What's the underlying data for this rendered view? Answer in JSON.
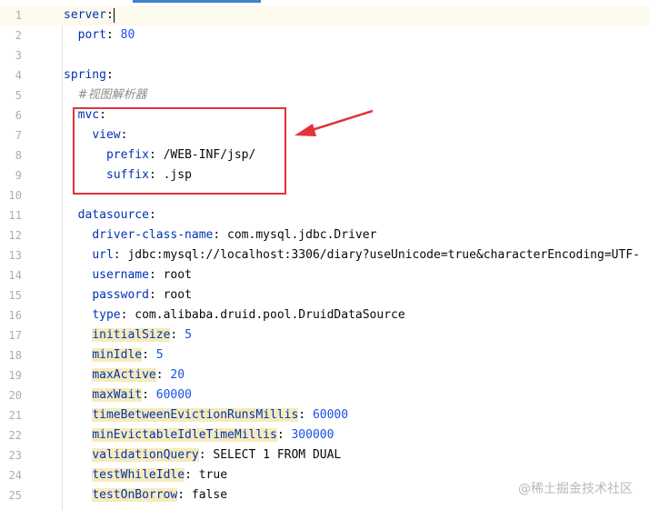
{
  "editor": {
    "lines": [
      {
        "n": "1",
        "indent": "",
        "key": "server",
        "value": "",
        "value_type": "",
        "caret": true
      },
      {
        "n": "2",
        "indent": "  ",
        "key": "port",
        "value": "80",
        "value_type": "num"
      },
      {
        "n": "3",
        "indent": "",
        "key": "",
        "value": "",
        "value_type": ""
      },
      {
        "n": "4",
        "indent": "",
        "key": "spring",
        "value": "",
        "value_type": ""
      },
      {
        "n": "5",
        "indent": "  ",
        "comment": "#视图解析器"
      },
      {
        "n": "6",
        "indent": "  ",
        "key": "mvc",
        "value": "",
        "value_type": ""
      },
      {
        "n": "7",
        "indent": "    ",
        "key": "view",
        "value": "",
        "value_type": ""
      },
      {
        "n": "8",
        "indent": "      ",
        "key": "prefix",
        "value": "/WEB-INF/jsp/",
        "value_type": "plain"
      },
      {
        "n": "9",
        "indent": "      ",
        "key": "suffix",
        "value": ".jsp",
        "value_type": "plain"
      },
      {
        "n": "10",
        "indent": "",
        "key": "",
        "value": "",
        "value_type": ""
      },
      {
        "n": "11",
        "indent": "  ",
        "key": "datasource",
        "value": "",
        "value_type": ""
      },
      {
        "n": "12",
        "indent": "    ",
        "key": "driver-class-name",
        "value": "com.mysql.jdbc.Driver",
        "value_type": "plain"
      },
      {
        "n": "13",
        "indent": "    ",
        "key": "url",
        "value": "jdbc:mysql://localhost:3306/diary?useUnicode=true&characterEncoding=UTF-",
        "value_type": "plain"
      },
      {
        "n": "14",
        "indent": "    ",
        "key": "username",
        "value": "root",
        "value_type": "plain"
      },
      {
        "n": "15",
        "indent": "    ",
        "key": "password",
        "value": "root",
        "value_type": "plain"
      },
      {
        "n": "16",
        "indent": "    ",
        "key": "type",
        "value": "com.alibaba.druid.pool.DruidDataSource",
        "value_type": "plain"
      },
      {
        "n": "17",
        "indent": "    ",
        "key": "initialSize",
        "value": "5",
        "value_type": "num",
        "hl": true
      },
      {
        "n": "18",
        "indent": "    ",
        "key": "minIdle",
        "value": "5",
        "value_type": "num",
        "hl": true
      },
      {
        "n": "19",
        "indent": "    ",
        "key": "maxActive",
        "value": "20",
        "value_type": "num",
        "hl": true
      },
      {
        "n": "20",
        "indent": "    ",
        "key": "maxWait",
        "value": "60000",
        "value_type": "num",
        "hl": true
      },
      {
        "n": "21",
        "indent": "    ",
        "key": "timeBetweenEvictionRunsMillis",
        "value": "60000",
        "value_type": "num",
        "hl": true
      },
      {
        "n": "22",
        "indent": "    ",
        "key": "minEvictableIdleTimeMillis",
        "value": "300000",
        "value_type": "num",
        "hl": true
      },
      {
        "n": "23",
        "indent": "    ",
        "key": "validationQuery",
        "value": "SELECT 1 FROM DUAL",
        "value_type": "plain",
        "hl": true
      },
      {
        "n": "24",
        "indent": "    ",
        "key": "testWhileIdle",
        "value": "true",
        "value_type": "plain",
        "hl": true
      },
      {
        "n": "25",
        "indent": "    ",
        "key": "testOnBorrow",
        "value": "false",
        "value_type": "plain",
        "hl": true
      }
    ]
  },
  "colors": {
    "key": "#0033b3",
    "number": "#1750eb",
    "highlight": "#f6ebbc",
    "callout": "#e0333a",
    "tab_indicator": "#4083c9"
  },
  "watermark": "@稀土掘金技术社区"
}
